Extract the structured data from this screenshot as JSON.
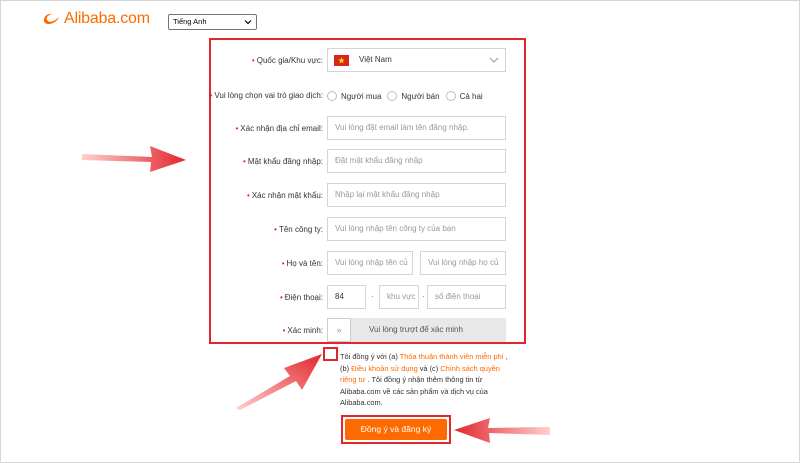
{
  "brand": {
    "name": "Alibaba.com",
    "accent": "#ff6a00"
  },
  "language_select": {
    "value": "Tiếng Anh"
  },
  "form": {
    "country": {
      "label": "Quốc gia/Khu vực:",
      "value": "Việt Nam",
      "flag_icon": "vietnam-flag-icon"
    },
    "role": {
      "label": "Vui lòng chọn vai trò giao dịch:",
      "options": [
        "Người mua",
        "Người bán",
        "Cả hai"
      ]
    },
    "email": {
      "label": "Xác nhận địa chỉ email:",
      "placeholder": "Vui lòng đặt email làm tên đăng nhập."
    },
    "password": {
      "label": "Mật khẩu đăng nhập:",
      "placeholder": "Đặt mật khẩu đăng nhập"
    },
    "confirm_password": {
      "label": "Xác nhận mật khẩu:",
      "placeholder": "Nhập lại mật khẩu đăng nhập"
    },
    "company": {
      "label": "Tên công ty:",
      "placeholder": "Vui lòng nhập tên công ty của bạn"
    },
    "name": {
      "label": "Họ và tên:",
      "first_placeholder": "Vui lòng nhập tên củ",
      "last_placeholder": "Vui lòng nhập họ củ"
    },
    "phone": {
      "label": "Điện thoại:",
      "country_code": "84",
      "area_placeholder": "khu vực",
      "number_placeholder": "số điện thoại"
    },
    "verify": {
      "label": "Xác minh:",
      "slider_text": "Vui lòng trượt để xác minh",
      "handle": "»"
    }
  },
  "agreement": {
    "t1": "Tôi đồng ý với (a) ",
    "link1": "Thỏa thuận thành viên miễn phí",
    "t2": " , (b) ",
    "link2": "Điều khoản sử dụng",
    "t3": " và (c) ",
    "link3": "Chính sách quyền riêng tư",
    "t4": " . Tôi đồng ý nhận thêm thông tin từ Alibaba.com về các sản phẩm và dịch vụ của Alibaba.com."
  },
  "submit": {
    "label": "Đồng ý và đăng ký"
  },
  "annotation_color": "#e3262d"
}
